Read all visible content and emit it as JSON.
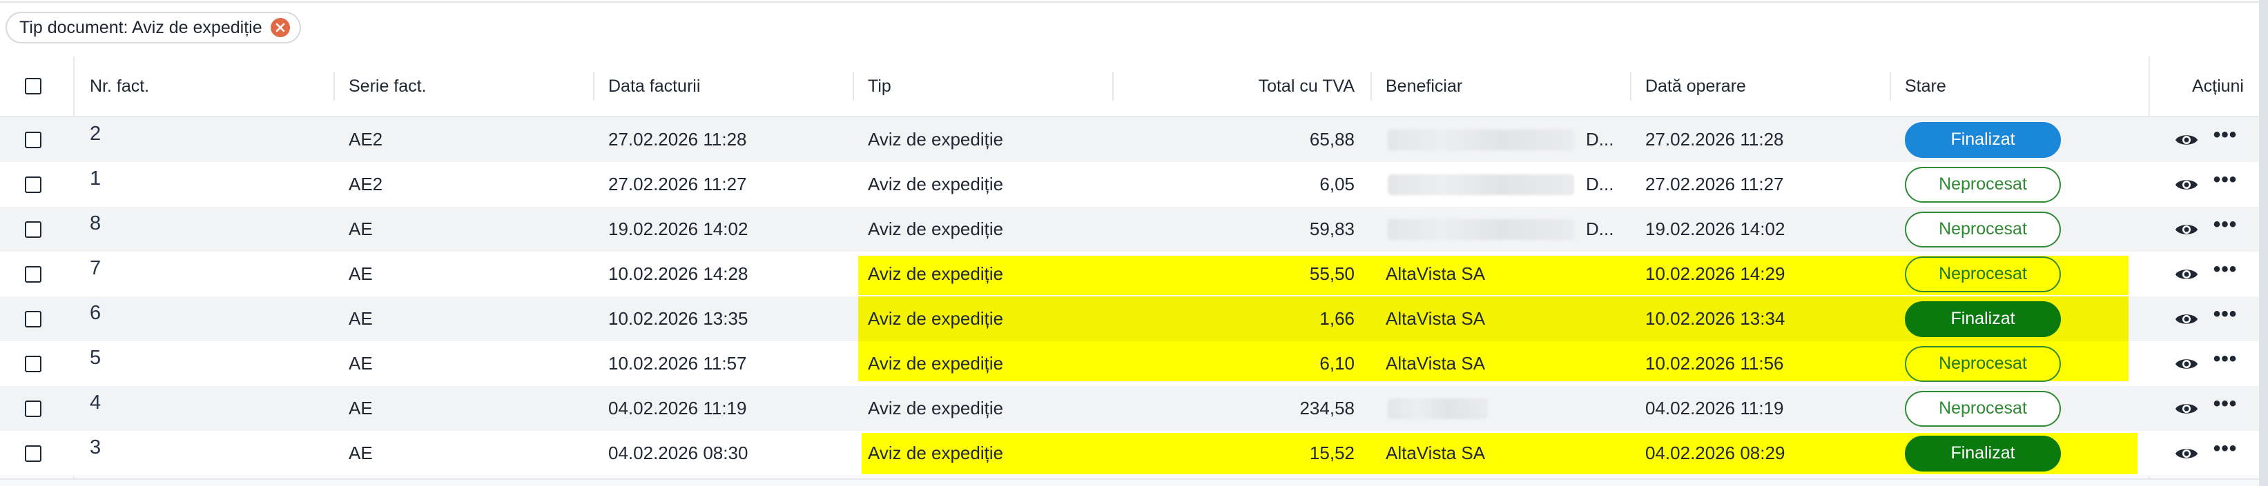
{
  "filter": {
    "label": "Tip document: Aviz de expediție"
  },
  "table": {
    "headers": {
      "nr": "Nr. fact.",
      "serie": "Serie fact.",
      "data": "Data facturii",
      "tip": "Tip",
      "total": "Total cu TVA",
      "beneficiar": "Beneficiar",
      "data_operare": "Dată operare",
      "stare": "Stare",
      "actiuni": "Acțiuni"
    },
    "rows": [
      {
        "nr": "2",
        "serie": "AE2",
        "data": "27.02.2026 11:28",
        "tip": "Aviz de expediție",
        "total": "65,88",
        "beneficiar": "D...",
        "data_operare": "27.02.2026 11:28",
        "stare": "Finalizat"
      },
      {
        "nr": "1",
        "serie": "AE2",
        "data": "27.02.2026 11:27",
        "tip": "Aviz de expediție",
        "total": "6,05",
        "beneficiar": "D...",
        "data_operare": "27.02.2026 11:27",
        "stare": "Neprocesat"
      },
      {
        "nr": "8",
        "serie": "AE",
        "data": "19.02.2026 14:02",
        "tip": "Aviz de expediție",
        "total": "59,83",
        "beneficiar": "D...",
        "data_operare": "19.02.2026 14:02",
        "stare": "Neprocesat"
      },
      {
        "nr": "7",
        "serie": "AE",
        "data": "10.02.2026 14:28",
        "tip": "Aviz de expediție",
        "total": "55,50",
        "beneficiar": "AltaVista SA",
        "data_operare": "10.02.2026 14:29",
        "stare": "Neprocesat"
      },
      {
        "nr": "6",
        "serie": "AE",
        "data": "10.02.2026 13:35",
        "tip": "Aviz de expediție",
        "total": "1,66",
        "beneficiar": "AltaVista SA",
        "data_operare": "10.02.2026 13:34",
        "stare": "Finalizat"
      },
      {
        "nr": "5",
        "serie": "AE",
        "data": "10.02.2026 11:57",
        "tip": "Aviz de expediție",
        "total": "6,10",
        "beneficiar": "AltaVista SA",
        "data_operare": "10.02.2026 11:56",
        "stare": "Neprocesat"
      },
      {
        "nr": "4",
        "serie": "AE",
        "data": "04.02.2026 11:19",
        "tip": "Aviz de expediție",
        "total": "234,58",
        "beneficiar": "",
        "data_operare": "04.02.2026 11:19",
        "stare": "Neprocesat"
      },
      {
        "nr": "3",
        "serie": "AE",
        "data": "04.02.2026 08:30",
        "tip": "Aviz de expediție",
        "total": "15,52",
        "beneficiar": "AltaVista SA",
        "data_operare": "04.02.2026 08:29",
        "stare": "Finalizat"
      }
    ]
  },
  "colors": {
    "highlight": "#ffff00",
    "status_finalizat_blue": "#1a87d9",
    "status_finalizat_green": "#0a7a0f",
    "status_neprocesat": "#2f8a34",
    "chip_close": "#e06a45"
  },
  "icons": {
    "chip_close": "close-icon",
    "view": "eye-icon",
    "more": "more-horizontal-icon"
  }
}
